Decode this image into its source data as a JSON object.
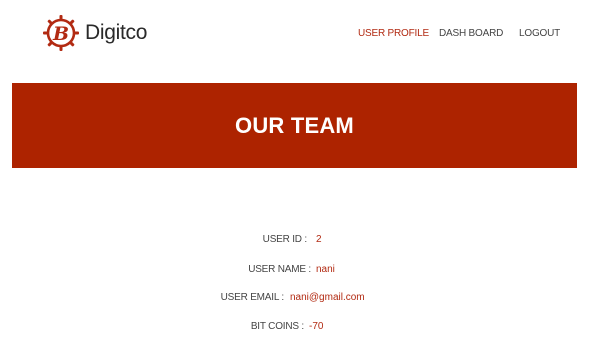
{
  "brand": {
    "name": "Digitco",
    "logo_icon": "b-circle-logo",
    "accent_color": "#b22a12"
  },
  "nav": {
    "items": [
      {
        "label": "USER PROFILE",
        "active": true
      },
      {
        "label": "DASH BOARD",
        "active": false
      },
      {
        "label": "LOGOUT",
        "active": false
      }
    ]
  },
  "banner": {
    "title": "OUR TEAM",
    "background": "#ad2300"
  },
  "profile": {
    "fields": [
      {
        "label": "USER ID :",
        "value": "2"
      },
      {
        "label": "USER NAME :",
        "value": "nani"
      },
      {
        "label": "USER EMAIL :",
        "value": "nani@gmail.com"
      },
      {
        "label": "BIT COINS :",
        "value": "-70"
      }
    ]
  }
}
